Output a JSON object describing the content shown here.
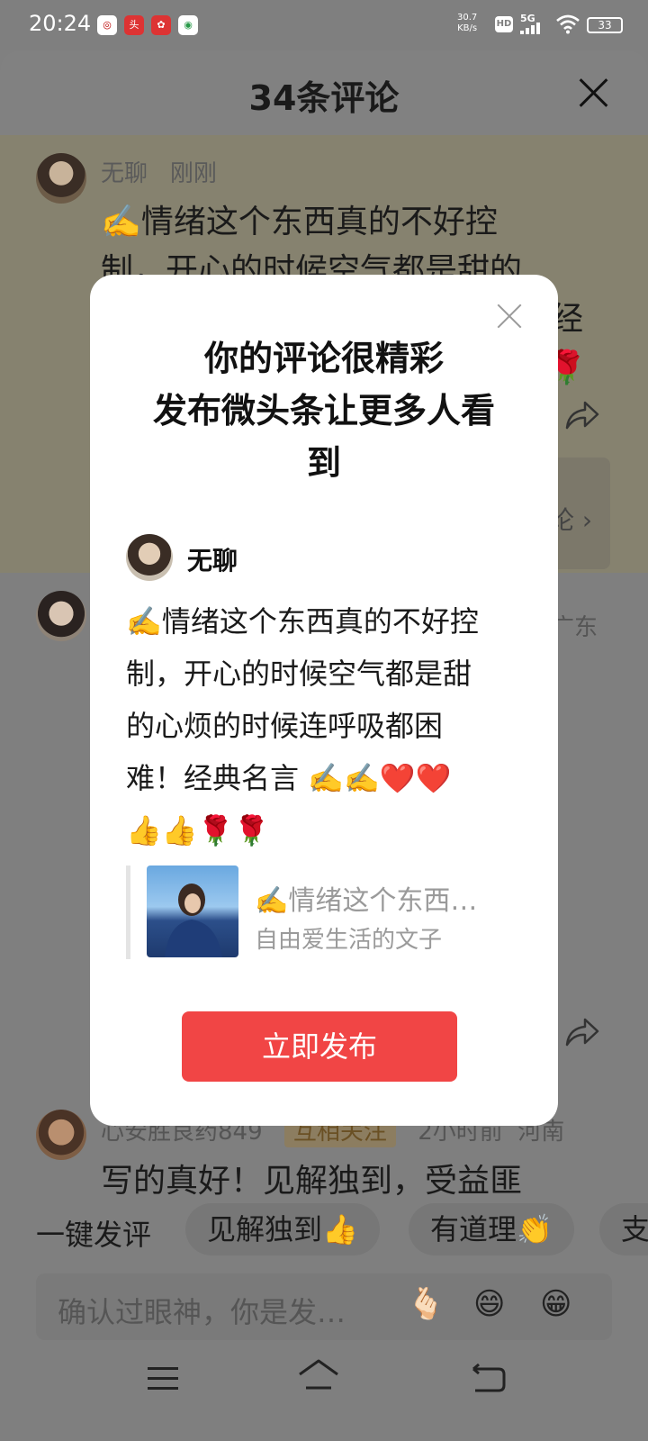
{
  "status_bar": {
    "time": "20:24",
    "network_speed": "30.7",
    "network_speed_unit": "KB/s",
    "hd_label": "HD",
    "network_type": "5G",
    "battery": "33"
  },
  "sheet": {
    "title": "34条评论",
    "comments": [
      {
        "user": "无聊",
        "time": "刚刚",
        "text": "✍️情绪这个东西真的不好控制，开心的时候空气都是甜的心烦的时候连呼吸都困难！经典名言 ✍️✍️❤️❤️👍👍🌹🌹",
        "visible_lines": [
          "✍️情绪这个东西真的不好控",
          "制，开心的时候空气都是甜的",
          "经",
          "🌹"
        ]
      },
      {
        "region_suffix": "广东"
      },
      {
        "user": "心安胜良药849",
        "badge": "互相关注",
        "time": "2小时前",
        "region": "河南",
        "text": "写的真好！见解独到，受益匪"
      }
    ],
    "quick_comment": {
      "label": "一键发评",
      "chips": [
        "见解独到👍",
        "有道理👏",
        "支"
      ]
    },
    "input": {
      "placeholder": "确认过眼神，你是发…",
      "emojis": [
        "🫰🏻",
        "😄",
        "😁"
      ]
    }
  },
  "dialog": {
    "title": "你的评论很精彩\n发布微头条让更多人看\n到",
    "title_lines": [
      "你的评论很精彩",
      "发布微头条让更多人看",
      "到"
    ],
    "user": "无聊",
    "body_lines": [
      "✍️情绪这个东西真的不好控",
      "制，开心的时候空气都是甜",
      "的心烦的时候连呼吸都困",
      "难！经典名言 ✍️✍️❤️❤️",
      "👍👍🌹🌹"
    ],
    "quote_title": "✍️情绪这个东西…",
    "quote_subtitle": "自由爱生活的文子",
    "publish_label": "立即发布"
  },
  "colors": {
    "publish_button": "#f14545",
    "overlay": "#808080"
  }
}
